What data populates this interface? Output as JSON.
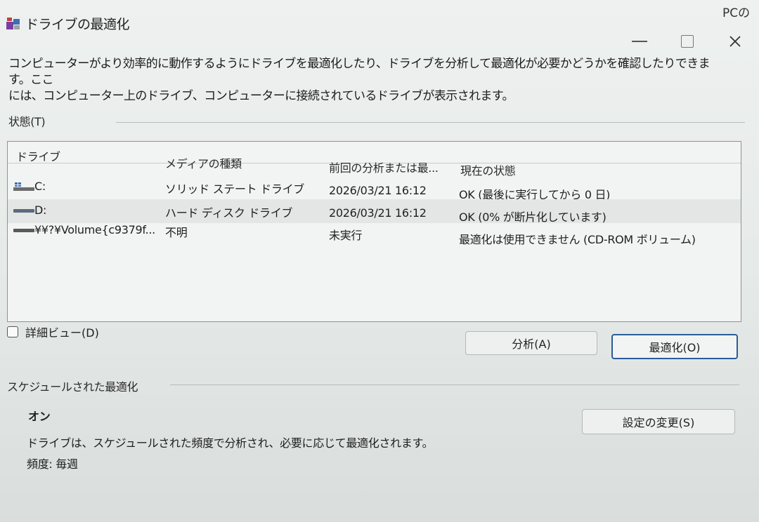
{
  "window": {
    "title": "ドライブの最適化",
    "corner_text": "PCの　",
    "description_line1": "コンピューターがより効率的に動作するようにドライブを最適化したり、ドライブを分析して最適化が必要かどうかを確認したりできます。ここ",
    "description_line2": "には、コンピューター上のドライブ、コンピューターに接続されているドライブが表示されます。"
  },
  "status": {
    "label": "状態(T)",
    "columns": [
      "ドライブ",
      "メディアの種類",
      "前回の分析または最...",
      "現在の状態"
    ],
    "rows": [
      {
        "drive": "C:",
        "media": "ソリッド ステート ドライブ",
        "last": "2026/03/21 16:12",
        "state": "OK (最後に実行してから 0 日)",
        "icon": "windows-drive-icon"
      },
      {
        "drive": "D:",
        "media": "ハード ディスク ドライブ",
        "last": "2026/03/21 16:12",
        "state": "OK (0% が断片化しています)",
        "icon": "drive-icon"
      },
      {
        "drive": "¥¥?¥Volume{c9379f...",
        "media": "不明",
        "last": "未実行",
        "state": "最適化は使用できません (CD-ROM ボリューム)",
        "icon": "drive-icon"
      }
    ]
  },
  "detail_view_label": "詳細ビュー(D)",
  "buttons": {
    "analyze": "分析(A)",
    "optimize": "最適化(O)",
    "change_settings": "設定の変更(S)"
  },
  "schedule": {
    "label": "スケジュールされた最適化",
    "state": "オン",
    "description": "ドライブは、スケジュールされた頻度で分析され、必要に応じて最適化されます。",
    "frequency": "頻度: 毎週"
  },
  "colors": {
    "accent": "#2b5c9a",
    "background": "#e6eae8"
  }
}
